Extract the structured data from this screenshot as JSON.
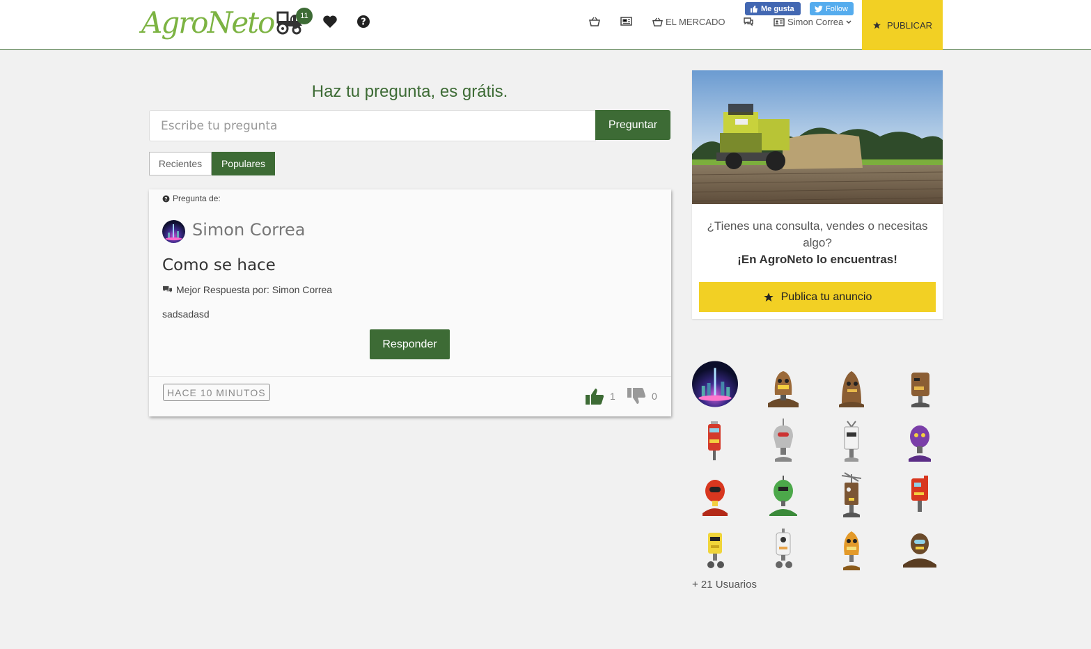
{
  "header": {
    "logo_text": "AgroNeto",
    "notification_count": "11",
    "nav": {
      "market_label": "EL MERCADO",
      "user_label": "Simon Correa",
      "publish_label": "PUBLICAR"
    },
    "social": {
      "facebook_label": "Me gusta",
      "twitter_label": "Follow"
    },
    "colors": {
      "brand_green": "#3d6b35",
      "logo_green": "#7cb342",
      "accent_yellow": "#f2d024"
    }
  },
  "ask": {
    "title": "Haz tu pregunta, es grátis.",
    "placeholder": "Escribe tu pregunta",
    "button_label": "Preguntar",
    "tabs": [
      {
        "label": "Recientes",
        "active": false
      },
      {
        "label": "Populares",
        "active": true
      }
    ]
  },
  "question": {
    "from_label": "Pregunta de:",
    "author": "Simon Correa",
    "title": "Como se hace",
    "best_answer_label": "Mejor Respuesta por: Simon Correa",
    "answer_text": "sadsadasd",
    "reply_label": "Responder",
    "time_label": "HACE 10 MINUTOS",
    "likes": "1",
    "dislikes": "0"
  },
  "ad": {
    "line1": "¿Tienes una consulta, vendes o necesitas algo?",
    "line2": "¡En AgroNeto lo encuentras!",
    "button_label": "Publica tu anuncio"
  },
  "users": {
    "more_label": "+ 21 Usuarios",
    "avatars": [
      "city-night-avatar",
      "robot-brown-avatar",
      "robot-brown-avatar",
      "robot-brown-avatar",
      "robot-red-avatar",
      "robot-grey-avatar",
      "robot-white-avatar",
      "robot-purple-avatar",
      "robot-red-avatar",
      "robot-green-avatar",
      "robot-brown-avatar",
      "robot-red-avatar",
      "robot-yellow-avatar",
      "robot-white-avatar",
      "robot-orange-avatar",
      "robot-brown-avatar"
    ]
  }
}
